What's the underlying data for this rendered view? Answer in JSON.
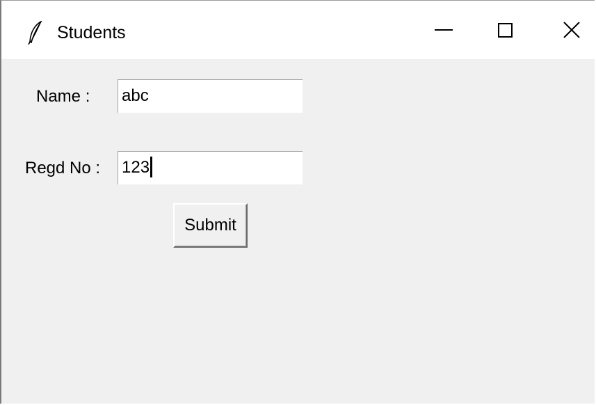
{
  "window": {
    "title": "Students",
    "icon": "feather-icon",
    "controls": {
      "minimize": "minimize-icon",
      "maximize": "maximize-icon",
      "close": "close-icon"
    }
  },
  "form": {
    "name_label": "Name :",
    "name_value": "abc",
    "regd_label": "Regd No :",
    "regd_value": "123",
    "submit_label": "Submit"
  },
  "colors": {
    "titlebar": "#ffffff",
    "client_area": "#f0f0f0",
    "entry_bg": "#ffffff"
  }
}
